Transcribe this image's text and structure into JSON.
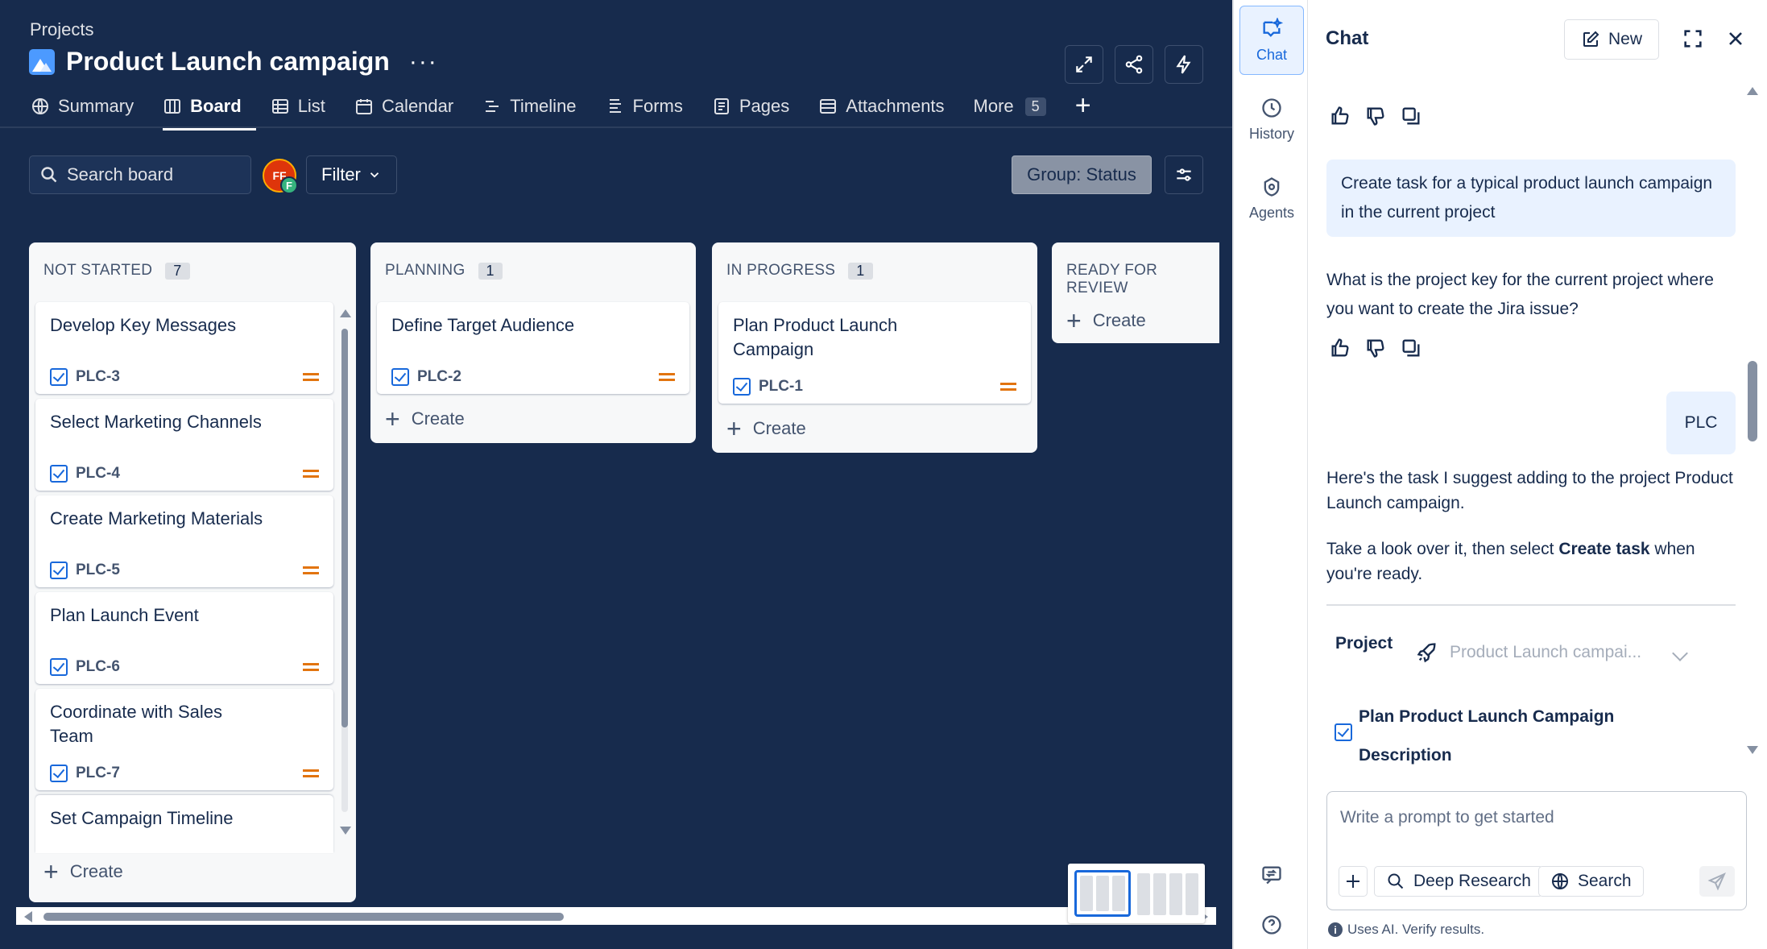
{
  "header": {
    "breadcrumb": "Projects",
    "title": "Product Launch campaign",
    "more_label": "···"
  },
  "tabs": [
    {
      "label": "Summary",
      "icon": "globe-icon"
    },
    {
      "label": "Board",
      "icon": "board-icon",
      "active": true
    },
    {
      "label": "List",
      "icon": "list-icon"
    },
    {
      "label": "Calendar",
      "icon": "calendar-icon"
    },
    {
      "label": "Timeline",
      "icon": "timeline-icon"
    },
    {
      "label": "Forms",
      "icon": "forms-icon"
    },
    {
      "label": "Pages",
      "icon": "pages-icon"
    },
    {
      "label": "Attachments",
      "icon": "attachments-icon"
    },
    {
      "label": "More",
      "count": "5"
    }
  ],
  "toolbar": {
    "search_placeholder": "Search board",
    "avatar_initials": "FF",
    "avatar_badge": "F",
    "filter_label": "Filter",
    "group_label": "Group: Status"
  },
  "columns": [
    {
      "name": "NOT STARTED",
      "count": "7",
      "cards": [
        {
          "title": "Develop Key Messages",
          "key": "PLC-3"
        },
        {
          "title": "Select Marketing Channels",
          "key": "PLC-4"
        },
        {
          "title": "Create Marketing Materials",
          "key": "PLC-5"
        },
        {
          "title": "Plan Launch Event",
          "key": "PLC-6"
        },
        {
          "title": "Coordinate with Sales Team",
          "key": "PLC-7"
        },
        {
          "title": "Set Campaign Timeline",
          "key": ""
        }
      ],
      "create_label": "Create"
    },
    {
      "name": "PLANNING",
      "count": "1",
      "cards": [
        {
          "title": "Define Target Audience",
          "key": "PLC-2"
        }
      ],
      "create_label": "Create"
    },
    {
      "name": "IN PROGRESS",
      "count": "1",
      "cards": [
        {
          "title": "Plan Product Launch Campaign",
          "key": "PLC-1"
        }
      ],
      "create_label": "Create"
    },
    {
      "name": "READY FOR REVIEW",
      "count": "",
      "cards": [],
      "create_label": "Create"
    }
  ],
  "rail": {
    "chat": "Chat",
    "history": "History",
    "agents": "Agents"
  },
  "chat": {
    "title": "Chat",
    "new_label": "New",
    "user_msg_1": "Create task for a typical product launch campaign in the current project",
    "bot_msg_1": "What is the project key for the current project where you want to create the Jira issue?",
    "user_msg_2": "PLC",
    "bot_msg_2a": "Here's the task I suggest adding to the project Product Launch campaign.",
    "bot_msg_2b_pre": "Take a look over it, then select ",
    "bot_msg_2b_bold": "Create task",
    "bot_msg_2b_post": " when you're ready.",
    "project_label": "Project",
    "project_value": "Product Launch campai...",
    "task_title": "Plan Product Launch Campaign",
    "description_label": "Description",
    "prompt_placeholder": "Write a prompt to get started",
    "deep_research_label": "Deep Research",
    "search_label": "Search",
    "disclaimer": "Uses AI. Verify results."
  },
  "colors": {
    "board_bg": "#172b4d",
    "accent": "#1868db",
    "priority_medium": "#e2740f"
  }
}
